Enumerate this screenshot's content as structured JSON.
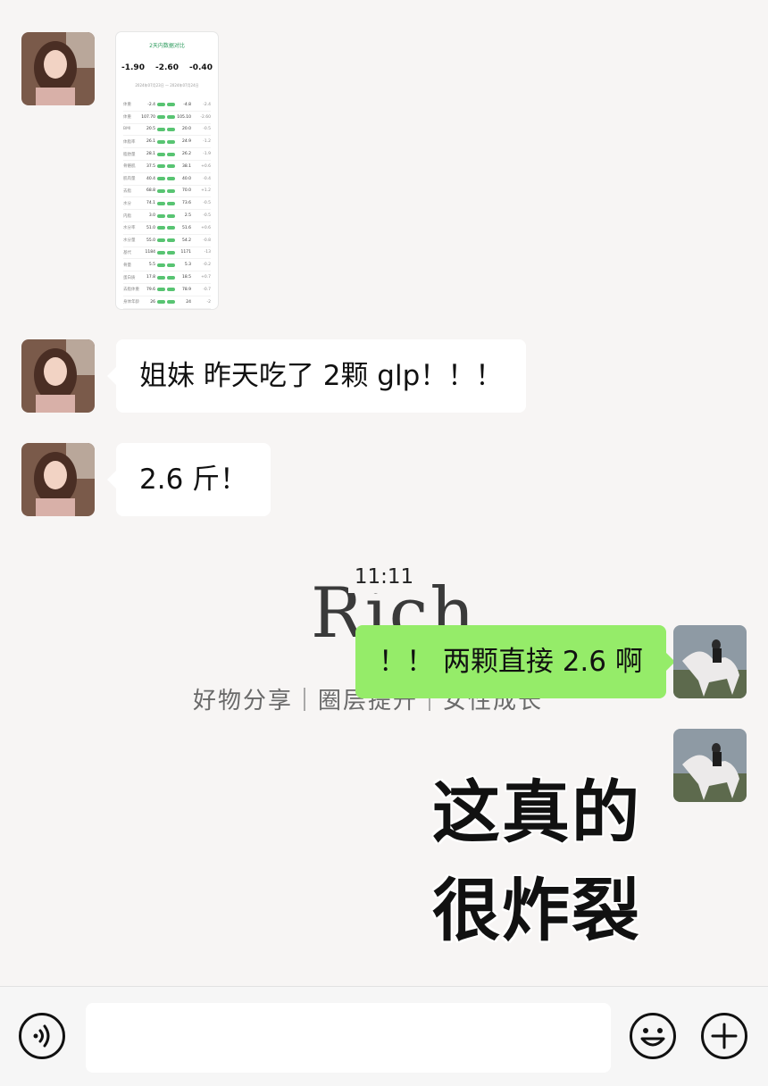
{
  "chat": {
    "image_message": {
      "title": "2天内数据对比",
      "metrics": [
        "-1.90",
        "-2.60",
        "-0.40"
      ],
      "date_range": "2024年07月23日 — 2024年07月24日",
      "rows": [
        {
          "label": "体重",
          "a": "-2.4",
          "b": "-4.8",
          "d": "-2.4"
        },
        {
          "label": "体重",
          "a": "107.70",
          "b": "105.10",
          "d": "-2.60"
        },
        {
          "label": "BMI",
          "a": "20.5",
          "b": "20.0",
          "d": "-0.5"
        },
        {
          "label": "体脂率",
          "a": "26.1",
          "b": "24.9",
          "d": "-1.2"
        },
        {
          "label": "脂肪量",
          "a": "28.1",
          "b": "26.2",
          "d": "-1.9"
        },
        {
          "label": "骨骼肌",
          "a": "37.5",
          "b": "38.1",
          "d": "+0.6"
        },
        {
          "label": "肌肉量",
          "a": "40.4",
          "b": "40.0",
          "d": "-0.4"
        },
        {
          "label": "去脂",
          "a": "68.8",
          "b": "70.0",
          "d": "+1.2"
        },
        {
          "label": "水分",
          "a": "74.1",
          "b": "73.6",
          "d": "-0.5"
        },
        {
          "label": "内脂",
          "a": "3.0",
          "b": "2.5",
          "d": "-0.5"
        },
        {
          "label": "水分率",
          "a": "51.0",
          "b": "51.6",
          "d": "+0.6"
        },
        {
          "label": "水分量",
          "a": "55.0",
          "b": "54.2",
          "d": "-0.8"
        },
        {
          "label": "基代",
          "a": "1184",
          "b": "1171",
          "d": "-13"
        },
        {
          "label": "骨量",
          "a": "5.5",
          "b": "5.3",
          "d": "-0.2"
        },
        {
          "label": "蛋白质",
          "a": "17.8",
          "b": "18.5",
          "d": "+0.7"
        },
        {
          "label": "去脂体重",
          "a": "79.6",
          "b": "78.9",
          "d": "-0.7"
        },
        {
          "label": "身体年龄",
          "a": "26",
          "b": "24",
          "d": "-2"
        }
      ]
    },
    "msg1": "姐妹 昨天吃了 2颗 glp！！！",
    "msg2": "2.6 斤！",
    "timestamp": "11:11",
    "background_word": "Rich",
    "background_tagline": "好物分享｜圈层提升｜女性成长",
    "msg3": "！！ 两颗直接 2.6 啊",
    "sticker_line1": "这真的",
    "sticker_line2": "很炸裂"
  },
  "input_bar": {
    "voice_icon": "voice-icon",
    "emoji_icon": "emoji-icon",
    "plus_icon": "plus-icon"
  },
  "colors": {
    "sent_bubble": "#95ec69",
    "received_bubble": "#ffffff",
    "background": "#f7f5f4"
  }
}
